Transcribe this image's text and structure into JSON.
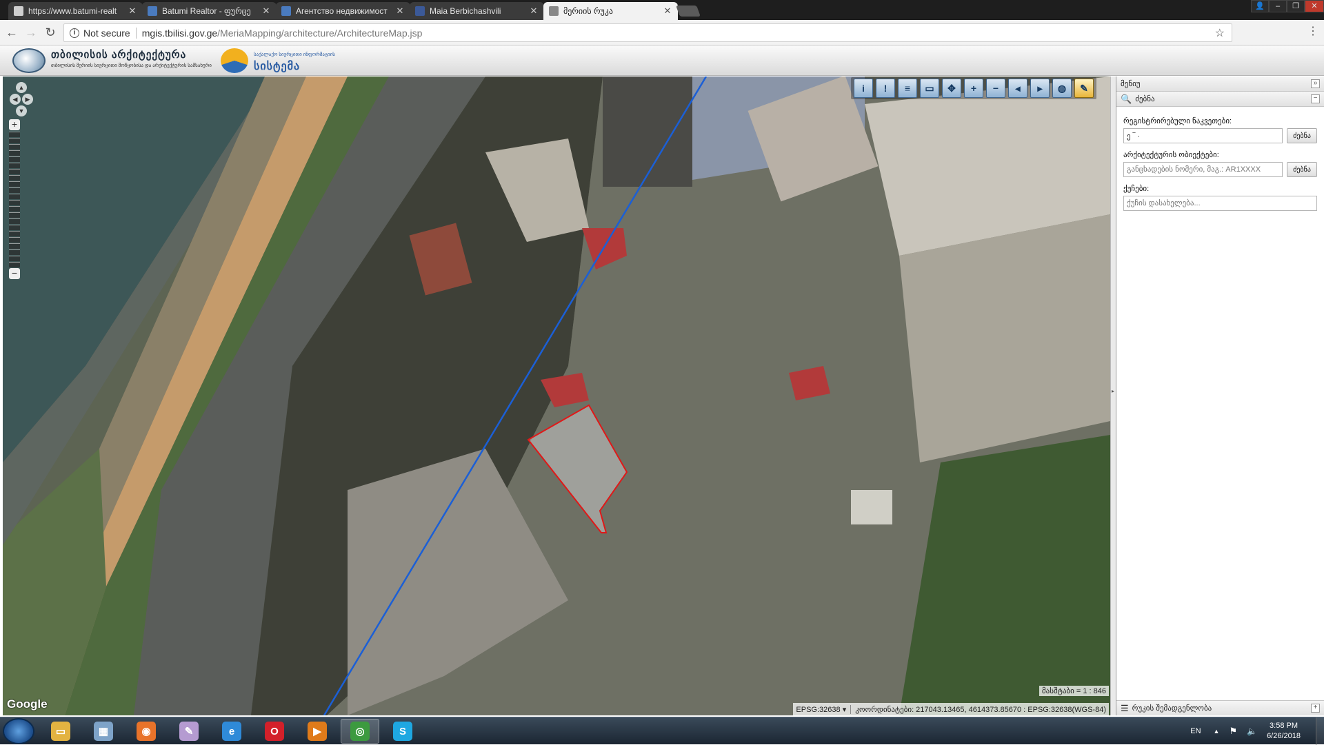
{
  "browser": {
    "tabs": [
      {
        "title": "https://www.batumi-realt",
        "favicon_color": "#cfcfcf",
        "active": false
      },
      {
        "title": "Batumi Realtor - ფურცე",
        "favicon_color": "#4a7bbf",
        "active": false
      },
      {
        "title": "Агентство недвижимост",
        "favicon_color": "#4a7bbf",
        "active": false
      },
      {
        "title": "Maia Berbichashvili",
        "favicon_color": "#3b5998",
        "active": false
      },
      {
        "title": "მერიის რუკა",
        "favicon_color": "#888888",
        "active": true
      }
    ],
    "security_label": "Not secure",
    "url_host": "mgis.tbilisi.gov.ge",
    "url_path": "/MeriaMapping/architecture/ArchitectureMap.jsp"
  },
  "header": {
    "logo1_title": "თბილისის არქიტექტურა",
    "logo1_subtitle": "თბილისის მერიის სივრცითი მოწყობისა და არქიტექტურის სამსახური",
    "logo2_top": "საქალაქო სივრცითი ინფორმაციის",
    "logo2_title": "სისტემა"
  },
  "map": {
    "attribution": "Google",
    "scale_text": "მასშტაბი = 1 : 846",
    "epsg_select": "EPSG:32638",
    "coordinates_text": "კოორდინატები: 217043.13465, 4614373.85670 : EPSG:32638(WGS-84)",
    "tools": [
      {
        "icon": "info-icon",
        "glyph": "i",
        "active": false
      },
      {
        "icon": "info-alt-icon",
        "glyph": "!",
        "active": false
      },
      {
        "icon": "layers-list-icon",
        "glyph": "≡",
        "active": false
      },
      {
        "icon": "measure-icon",
        "glyph": "▭",
        "active": false
      },
      {
        "icon": "pan-icon",
        "glyph": "✥",
        "active": false
      },
      {
        "icon": "zoom-in-icon",
        "glyph": "+",
        "active": false
      },
      {
        "icon": "zoom-out-icon",
        "glyph": "−",
        "active": false
      },
      {
        "icon": "zoom-previous-icon",
        "glyph": "◂",
        "active": false
      },
      {
        "icon": "zoom-next-icon",
        "glyph": "▸",
        "active": false
      },
      {
        "icon": "globe-icon",
        "glyph": "◍",
        "active": false
      },
      {
        "icon": "pencil-icon",
        "glyph": "✎",
        "active": true
      }
    ]
  },
  "panel": {
    "title": "მენიუ",
    "search_title": "ძებნა",
    "cadastral_label": "რეგისტრირებული ნაკვეთები:",
    "cadastral_value": "ე ‾ ·",
    "object_label": "არქიტექტურის ობიექტები:",
    "object_placeholder": "განცხადების ნომერი, მაგ.: AR1XXXX",
    "street_label": "ქუჩები:",
    "street_placeholder": "ქუჩის დასახელება...",
    "search_button": "ძებნა",
    "layers_title": "რუკის შემადგენლობა"
  },
  "taskbar": {
    "language": "EN",
    "time": "3:58 PM",
    "date": "6/26/2018",
    "apps": [
      {
        "name": "file-explorer-icon",
        "color": "#e3b341",
        "glyph": "▭",
        "active": false
      },
      {
        "name": "calculator-icon",
        "color": "#7ea3c8",
        "glyph": "▦",
        "active": false
      },
      {
        "name": "firefox-icon",
        "color": "#e8732a",
        "glyph": "◉",
        "active": false
      },
      {
        "name": "paint-icon",
        "color": "#b59bd1",
        "glyph": "✎",
        "active": false
      },
      {
        "name": "internet-explorer-icon",
        "color": "#2f8ad8",
        "glyph": "e",
        "active": false
      },
      {
        "name": "opera-icon",
        "color": "#d3202a",
        "glyph": "O",
        "active": false
      },
      {
        "name": "media-player-icon",
        "color": "#e07b1a",
        "glyph": "▶",
        "active": false
      },
      {
        "name": "chrome-icon",
        "color": "#3c9a3f",
        "glyph": "◎",
        "active": true
      },
      {
        "name": "skype-icon",
        "color": "#1ea7e1",
        "glyph": "S",
        "active": false
      }
    ]
  }
}
